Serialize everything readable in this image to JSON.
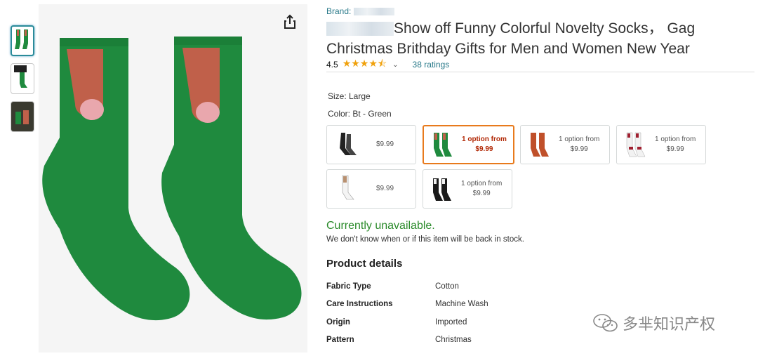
{
  "brand": {
    "label": "Brand:"
  },
  "title": {
    "text": "Show off Funny Colorful Novelty Socks， Gag Christmas Brithday Gifts for Men and Women New Year"
  },
  "rating": {
    "value": "4.5",
    "stars": "★★★★⯪",
    "count_label": "38 ratings"
  },
  "size": {
    "label": "Size: Large"
  },
  "color": {
    "label": "Color: Bt - Green"
  },
  "options": [
    {
      "line1": "",
      "line2": "$9.99"
    },
    {
      "line1": "1 option from",
      "line2": "$9.99"
    },
    {
      "line1": "1 option from",
      "line2": "$9.99"
    },
    {
      "line1": "1 option from",
      "line2": "$9.99"
    },
    {
      "line1": "",
      "line2": "$9.99"
    },
    {
      "line1": "1 option from",
      "line2": "$9.99"
    }
  ],
  "availability": {
    "status": "Currently unavailable.",
    "note": "We don't know when or if this item will be back in stock."
  },
  "product_details": {
    "title": "Product details",
    "rows": [
      {
        "key": "Fabric Type",
        "value": "Cotton"
      },
      {
        "key": "Care Instructions",
        "value": "Machine Wash"
      },
      {
        "key": "Origin",
        "value": "Imported"
      },
      {
        "key": "Pattern",
        "value": "Christmas"
      }
    ]
  },
  "watermark": {
    "text": "多芈知识产权"
  },
  "colors": {
    "sock_green": "#1f8a3e",
    "accent_teal": "#2a7a8a",
    "selected_orange": "#e87a1c",
    "available_green": "#2a8a2a"
  }
}
